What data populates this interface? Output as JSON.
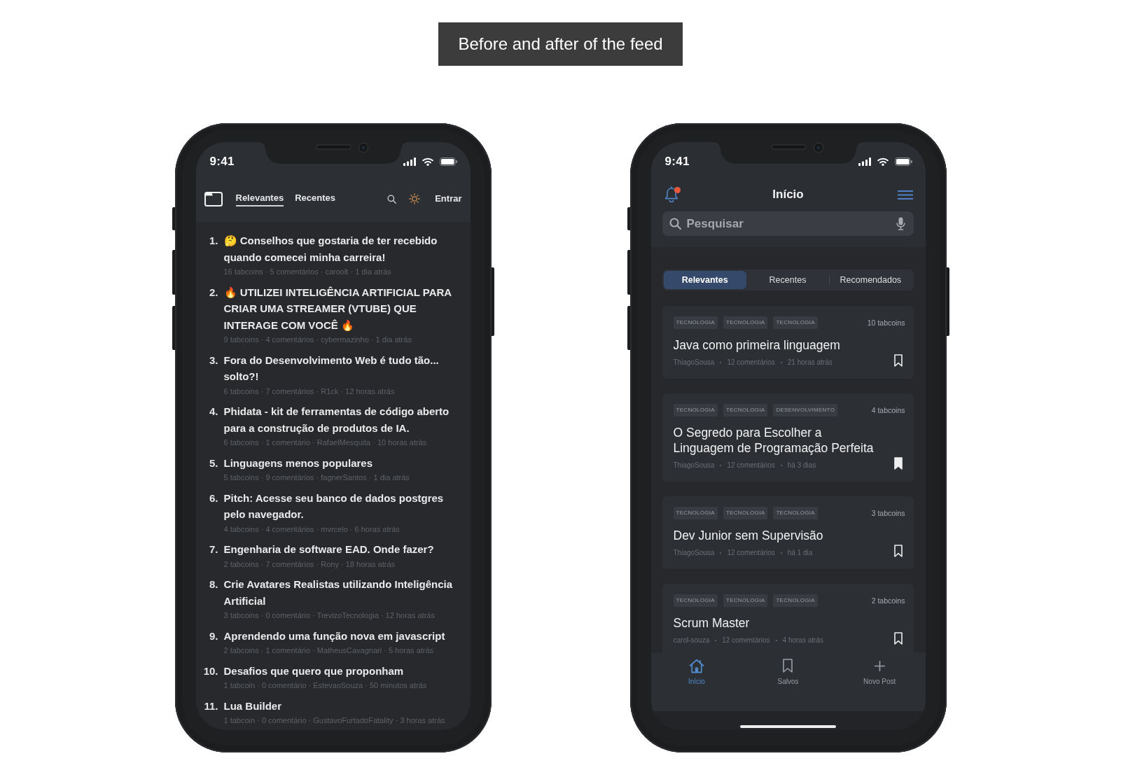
{
  "caption": "Before and after of the feed",
  "before": {
    "status_bar": {
      "time": "9:41"
    },
    "nav": {
      "tabs": [
        {
          "label": "Relevantes",
          "selected": true
        },
        {
          "label": "Recentes",
          "selected": false
        }
      ],
      "login": "Entrar"
    },
    "posts": [
      {
        "number": "1.",
        "title": "🤔 Conselhos que gostaria de ter recebido quando comecei minha carreira!",
        "meta": "16 tabcoins · 5 comentários · caroolt · 1 dia atrás"
      },
      {
        "number": "2.",
        "title": "🔥 UTILIZEI INTELIGÊNCIA ARTIFICIAL PARA CRIAR UMA STREAMER (VTUBE) QUE INTERAGE COM VOCÊ 🔥",
        "meta": "9 tabcoins · 4 comentários · cybermazinho · 1 dia atrás"
      },
      {
        "number": "3.",
        "title": "Fora do Desenvolvimento Web é tudo tão... solto?!",
        "meta": "6 tabcoins · 7 comentários · R1ck · 12 horas atrás"
      },
      {
        "number": "4.",
        "title": "Phidata - kit de ferramentas de código aberto para a construção de produtos de IA.",
        "meta": "6 tabcoins · 1 comentário · RafaelMesquita · 10 horas atrás"
      },
      {
        "number": "5.",
        "title": "Linguagens menos populares",
        "meta": "5 tabcoins · 9 comentários · fagnerSantos · 1 dia atrás"
      },
      {
        "number": "6.",
        "title": "Pitch: Acesse seu banco de dados postgres pelo navegador.",
        "meta": "4 tabcoins · 4 comentários · mvrcelo · 6 horas atrás"
      },
      {
        "number": "7.",
        "title": "Engenharia de software EAD. Onde fazer?",
        "meta": "2 tabcoins · 7 comentários · Rony · 18 horas atrás"
      },
      {
        "number": "8.",
        "title": "Crie Avatares Realistas utilizando Inteligência Artificial",
        "meta": "3 tabcoins · 0 comentário · TrevizoTecnologia · 12 horas atrás"
      },
      {
        "number": "9.",
        "title": "Aprendendo uma função nova em javascript",
        "meta": "2 tabcoins · 1 comentário · MatheusCavagnari · 5 horas atrás"
      },
      {
        "number": "10.",
        "title": "Desafios que quero que proponham",
        "meta": "1 tabcoin · 0 comentário · EstevaoSouza · 50 minutos atrás"
      },
      {
        "number": "11.",
        "title": "Lua Builder",
        "meta": "1 tabcoin · 0 comentário · GustavoFurtadoFatality · 3 horas atrás"
      }
    ]
  },
  "after": {
    "status_bar": {
      "time": "9:41"
    },
    "header": {
      "title": "Início",
      "unread": true
    },
    "search": {
      "placeholder": "Pesquisar"
    },
    "tabs": [
      {
        "label": "Relevantes",
        "selected": true
      },
      {
        "label": "Recentes",
        "selected": false
      },
      {
        "label": "Recomendados",
        "selected": false
      }
    ],
    "posts": [
      {
        "tags": [
          "TECNOLOGIA",
          "TECNOLOGIA",
          "TECNOLOGIA"
        ],
        "tabcoins": "10 tabcoins",
        "title": "Java como primeira linguagem",
        "meta": [
          "ThiagoSousa",
          "12 comentários",
          "21 horas atrás"
        ],
        "saved": false
      },
      {
        "tags": [
          "TECNOLOGIA",
          "TECNOLOGIA",
          "DESENVOLVIMENTO"
        ],
        "tabcoins": "4 tabcoins",
        "title": "O Segredo para Escolher a Linguagem de Programação Perfeita",
        "meta": [
          "ThiagoSousa",
          "12 comentários",
          "há 3 dias"
        ],
        "saved": true
      },
      {
        "tags": [
          "TECNOLOGIA",
          "TECNOLOGIA",
          "TECNOLOGIA"
        ],
        "tabcoins": "3 tabcoins",
        "title": "Dev Junior sem Supervisão",
        "meta": [
          "ThiagoSousa",
          "12 comentários",
          "há 1 dia"
        ],
        "saved": false
      },
      {
        "tags": [
          "TECNOLOGIA",
          "TECNOLOGIA",
          "TECNOLOGIA"
        ],
        "tabcoins": "2 tabcoins",
        "title": "Scrum Master",
        "meta": [
          "carol-souza",
          "12 comentários",
          "4 horas atrás"
        ],
        "saved": false
      }
    ],
    "tab_bar": [
      {
        "kind": "home",
        "label": "Início",
        "selected": true
      },
      {
        "kind": "bookmarks",
        "label": "Salvos",
        "selected": false
      },
      {
        "kind": "add",
        "label": "Novo Post",
        "selected": false
      }
    ]
  }
}
